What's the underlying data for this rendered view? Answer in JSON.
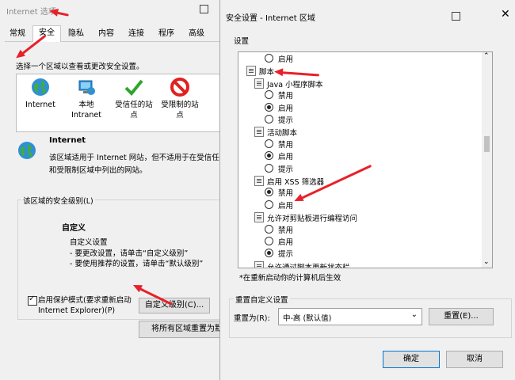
{
  "back_window": {
    "title": "Internet 选项",
    "tabs": [
      "常规",
      "安全",
      "隐私",
      "内容",
      "连接",
      "程序",
      "高级"
    ],
    "instruction": "选择一个区域以查看或更改安全设置。",
    "zones": [
      {
        "icon": "globe-icon",
        "label": "Internet"
      },
      {
        "icon": "local-intranet-icon",
        "label": "本地\nIntranet"
      },
      {
        "icon": "checkmark-icon",
        "label": "受信任的站\n点"
      },
      {
        "icon": "restricted-icon",
        "label": "受限制的站\n点"
      }
    ],
    "zone_heading": "Internet",
    "zone_description": "该区域适用于 Internet 网站，但不适用于在受信任\n和受限制区域中列出的网站。",
    "security_level_legend": "该区域的安全级别(L)",
    "custom_title": "自定义",
    "custom_lines": [
      "自定义设置",
      "- 要更改设置，请单击“自定义级别”",
      "- 要使用推荐的设置，请单击“默认级别”"
    ],
    "protected_mode_label": "启用保护模式(要求重新启动\nInternet Explorer)(P)",
    "custom_level_button": "自定义级别(C)...",
    "reset_all_button": "将所有区域重置为默"
  },
  "dialog": {
    "title": "安全设置 - Internet 区域",
    "settings_label": "设置",
    "tree": [
      {
        "type": "radio",
        "label": "启用",
        "checked": false,
        "indent": 2
      },
      {
        "type": "folder",
        "label": "脚本",
        "indent": 0
      },
      {
        "type": "folder",
        "label": "Java 小程序脚本",
        "indent": 1
      },
      {
        "type": "radio",
        "label": "禁用",
        "checked": false,
        "indent": 2
      },
      {
        "type": "radio",
        "label": "启用",
        "checked": true,
        "indent": 2
      },
      {
        "type": "radio",
        "label": "提示",
        "checked": false,
        "indent": 2
      },
      {
        "type": "folder",
        "label": "活动脚本",
        "indent": 1
      },
      {
        "type": "radio",
        "label": "禁用",
        "checked": false,
        "indent": 2
      },
      {
        "type": "radio",
        "label": "启用",
        "checked": true,
        "indent": 2
      },
      {
        "type": "radio",
        "label": "提示",
        "checked": false,
        "indent": 2
      },
      {
        "type": "folder",
        "label": "启用 XSS 筛选器",
        "indent": 1
      },
      {
        "type": "radio",
        "label": "禁用",
        "checked": true,
        "indent": 2
      },
      {
        "type": "radio",
        "label": "启用",
        "checked": false,
        "indent": 2
      },
      {
        "type": "folder",
        "label": "允许对剪贴板进行编程访问",
        "indent": 1
      },
      {
        "type": "radio",
        "label": "禁用",
        "checked": false,
        "indent": 2
      },
      {
        "type": "radio",
        "label": "启用",
        "checked": false,
        "indent": 2
      },
      {
        "type": "radio",
        "label": "提示",
        "checked": true,
        "indent": 2
      },
      {
        "type": "folder",
        "label": "允许通过脚本更新状态栏",
        "indent": 1
      }
    ],
    "restart_note": "*在重新启动你的计算机后生效",
    "reset_group_label": "重置自定义设置",
    "reset_to_label": "重置为(R):",
    "reset_select_value": "中-高 (默认值)",
    "reset_button": "重置(E)...",
    "ok_button": "确定",
    "cancel_button": "取消"
  },
  "colors": {
    "annotation_arrow": "#e8202a",
    "window_bg": "#f0f0f0"
  }
}
